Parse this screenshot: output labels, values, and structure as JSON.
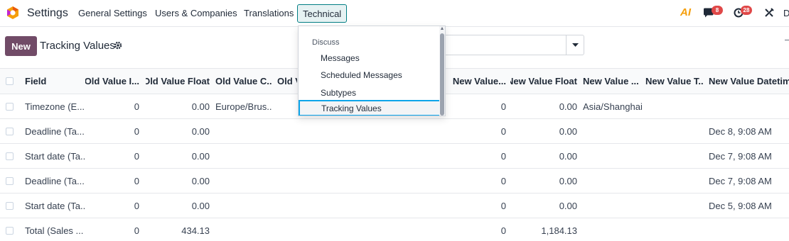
{
  "navbar": {
    "app_name": "Settings",
    "menu": [
      "General Settings",
      "Users & Companies",
      "Translations",
      "Technical"
    ],
    "active_menu": "Technical",
    "ai_label": "AI",
    "messages_count": "8",
    "activities_count": "28",
    "user_initial": "D"
  },
  "control_panel": {
    "new_label": "New",
    "title": "Tracking Values",
    "search_value": ""
  },
  "table": {
    "columns": [
      "Field",
      "Old Value I...",
      "Old Value Float",
      "Old Value C...",
      "Old V",
      "New Value...",
      "New Value Float",
      "New Value ...",
      "New Value T...",
      "New Value Datetime"
    ],
    "rows": [
      {
        "field": "Timezone (E...",
        "old_int": "0",
        "old_float": "0.00",
        "old_char": "Europe/Brus...",
        "new_int": "0",
        "new_float": "0.00",
        "new_char": "Asia/Shanghai",
        "new_datetime": ""
      },
      {
        "field": "Deadline (Ta...",
        "old_int": "0",
        "old_float": "0.00",
        "old_char": "",
        "new_int": "0",
        "new_float": "0.00",
        "new_char": "",
        "new_datetime": "Dec 8, 9:08 AM"
      },
      {
        "field": "Start date (Ta...",
        "old_int": "0",
        "old_float": "0.00",
        "old_char": "",
        "new_int": "0",
        "new_float": "0.00",
        "new_char": "",
        "new_datetime": "Dec 7, 9:08 AM"
      },
      {
        "field": "Deadline (Ta...",
        "old_int": "0",
        "old_float": "0.00",
        "old_char": "",
        "new_int": "0",
        "new_float": "0.00",
        "new_char": "",
        "new_datetime": "Dec 7, 9:08 AM"
      },
      {
        "field": "Start date (Ta...",
        "old_int": "0",
        "old_float": "0.00",
        "old_char": "",
        "new_int": "0",
        "new_float": "0.00",
        "new_char": "",
        "new_datetime": "Dec 5, 9:08 AM"
      },
      {
        "field": "Total (Sales ...",
        "old_int": "0",
        "old_float": "434.13",
        "old_char": "",
        "new_int": "0",
        "new_float": "1,184.13",
        "new_char": "",
        "new_datetime": ""
      }
    ]
  },
  "dropdown": {
    "section": "Discuss",
    "items": [
      "Messages",
      "Scheduled Messages",
      "Subtypes",
      "Tracking Values"
    ],
    "focused_item": "Tracking Values"
  },
  "colors": {
    "brand": "#714b67",
    "teal": "#017e84",
    "badge": "#e04848",
    "focus": "#0ea5e9"
  },
  "icons": [
    "app-logo-icon",
    "chat-icon",
    "clock-icon",
    "tools-icon",
    "gear-icon",
    "caret-down-icon",
    "ai-icon"
  ]
}
